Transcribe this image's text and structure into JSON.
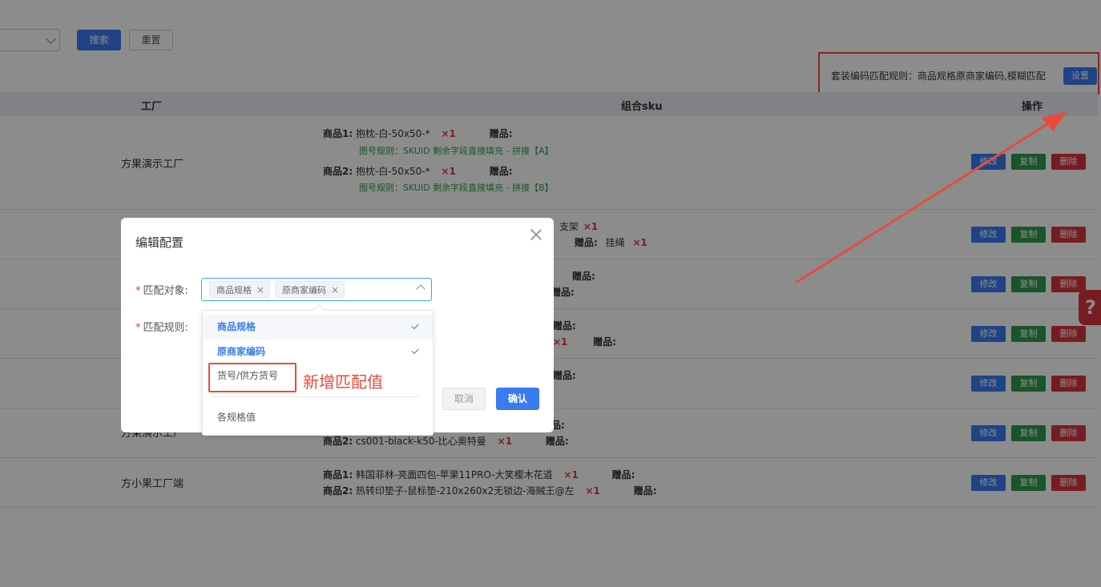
{
  "toolbar": {
    "search_label": "搜索",
    "reset_label": "重置"
  },
  "rule_banner": {
    "text": "套装编码匹配规则：商品规格原商家编码,模糊匹配",
    "set_label": "设置"
  },
  "table": {
    "headers": {
      "factory": "工厂",
      "sku": "组合sku",
      "ops": "操作"
    },
    "op_labels": {
      "edit": "修改",
      "copy": "复制",
      "del": "删除"
    },
    "rows": [
      {
        "factory": "方果演示工厂",
        "lines": [
          {
            "label": "商品1:",
            "name": "抱枕-白-50x50-*",
            "qty": "×1",
            "gift": "赠品:"
          },
          {
            "label": "商品2:",
            "name": "抱枕-白-50x50-*",
            "qty": "×1",
            "gift": "赠品:"
          }
        ],
        "rules": [
          "图号规则：SKUID   剩余字段直接填充 - 拼接【A】",
          "图号规则：SKUID   剩余字段直接填充 - 拼接【B】"
        ]
      },
      {
        "fragment1": "支架",
        "fragment1_qty": "×1",
        "fragment2_gift": "赠品:",
        "fragment2": "挂绳",
        "fragment2_qty": "×1"
      },
      {
        "gift_a": "赠品:",
        "gift_b": "赠品:"
      },
      {
        "gift_a": "赠品:",
        "qty": "×1",
        "gift_b": "赠品:"
      },
      {
        "gift_a": "赠品:"
      },
      {
        "factory": "方果演示工厂",
        "line2": {
          "label": "商品2:",
          "name": "cs001-black-k50-比心奥特曼",
          "qty": "×1",
          "gift": "赠品:"
        },
        "gift_top": "赠品:"
      },
      {
        "factory": "方小果工厂端",
        "lines": [
          {
            "label": "商品1:",
            "name": "韩国菲林-亮面四包-苹果11PRO-大笑樱木花道",
            "qty": "×1",
            "gift": "赠品:"
          },
          {
            "label": "商品2:",
            "name": "热转印垫子-鼠标垫-210x260x2无锁边-海贼王@左",
            "qty": "×1",
            "gift": "赠品:"
          }
        ]
      }
    ]
  },
  "help_tab": "?",
  "modal": {
    "title": "编辑配置",
    "match_object_label": "匹配对象:",
    "match_rule_label": "匹配规则:",
    "required_mark": "*",
    "selected_tags": [
      "商品规格",
      "原商家编码"
    ],
    "tag_remove": "×",
    "cancel_label": "取消",
    "ok_label": "确认"
  },
  "dropdown": {
    "options": [
      {
        "label": "商品规格",
        "selected": true
      },
      {
        "label": "原商家编码",
        "selected": true
      },
      {
        "label": "货号/供方货号",
        "selected": false
      },
      {
        "label": "各规格值",
        "selected": false
      }
    ]
  },
  "annotation": {
    "text": "新增匹配值"
  },
  "colors": {
    "primary": "#3a7bf0",
    "success": "#2e9b4b",
    "danger": "#d9363e",
    "annotation": "#e74c3c"
  }
}
